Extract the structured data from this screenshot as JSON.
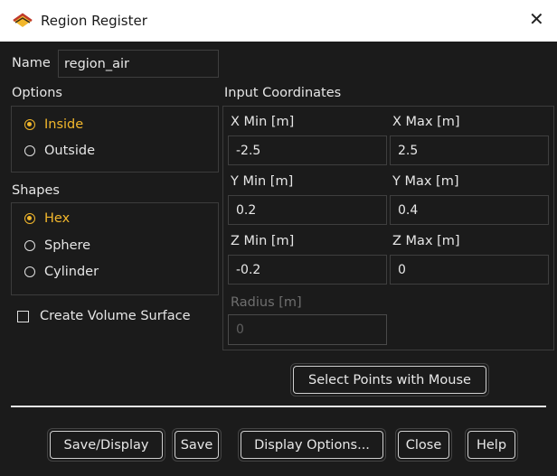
{
  "window": {
    "title": "Region Register",
    "close_glyph": "✕",
    "app_icon": "fluent-icon"
  },
  "name": {
    "label": "Name",
    "value": "region_air"
  },
  "options": {
    "label": "Options",
    "items": [
      {
        "label": "Inside",
        "selected": true
      },
      {
        "label": "Outside",
        "selected": false
      }
    ]
  },
  "shapes": {
    "label": "Shapes",
    "items": [
      {
        "label": "Hex",
        "selected": true
      },
      {
        "label": "Sphere",
        "selected": false
      },
      {
        "label": "Cylinder",
        "selected": false
      }
    ]
  },
  "create_volume_surface": {
    "label": "Create Volume Surface",
    "checked": false
  },
  "coords": {
    "label": "Input Coordinates",
    "x_min": {
      "label": "X Min [m]",
      "value": "-2.5"
    },
    "x_max": {
      "label": "X Max [m]",
      "value": "2.5"
    },
    "y_min": {
      "label": "Y Min [m]",
      "value": "0.2"
    },
    "y_max": {
      "label": "Y Max [m]",
      "value": "0.4"
    },
    "z_min": {
      "label": "Z Min [m]",
      "value": "-0.2"
    },
    "z_max": {
      "label": "Z Max [m]",
      "value": "0"
    },
    "radius": {
      "label": "Radius [m]",
      "value": "0",
      "disabled": true
    }
  },
  "select_points_button": "Select Points with Mouse",
  "buttons": {
    "save_display": "Save/Display",
    "save": "Save",
    "display_options": "Display Options...",
    "close": "Close",
    "help": "Help"
  },
  "colors": {
    "accent": "#f2b72c",
    "background": "#1b1b1b",
    "titlebar": "#ffffff"
  }
}
